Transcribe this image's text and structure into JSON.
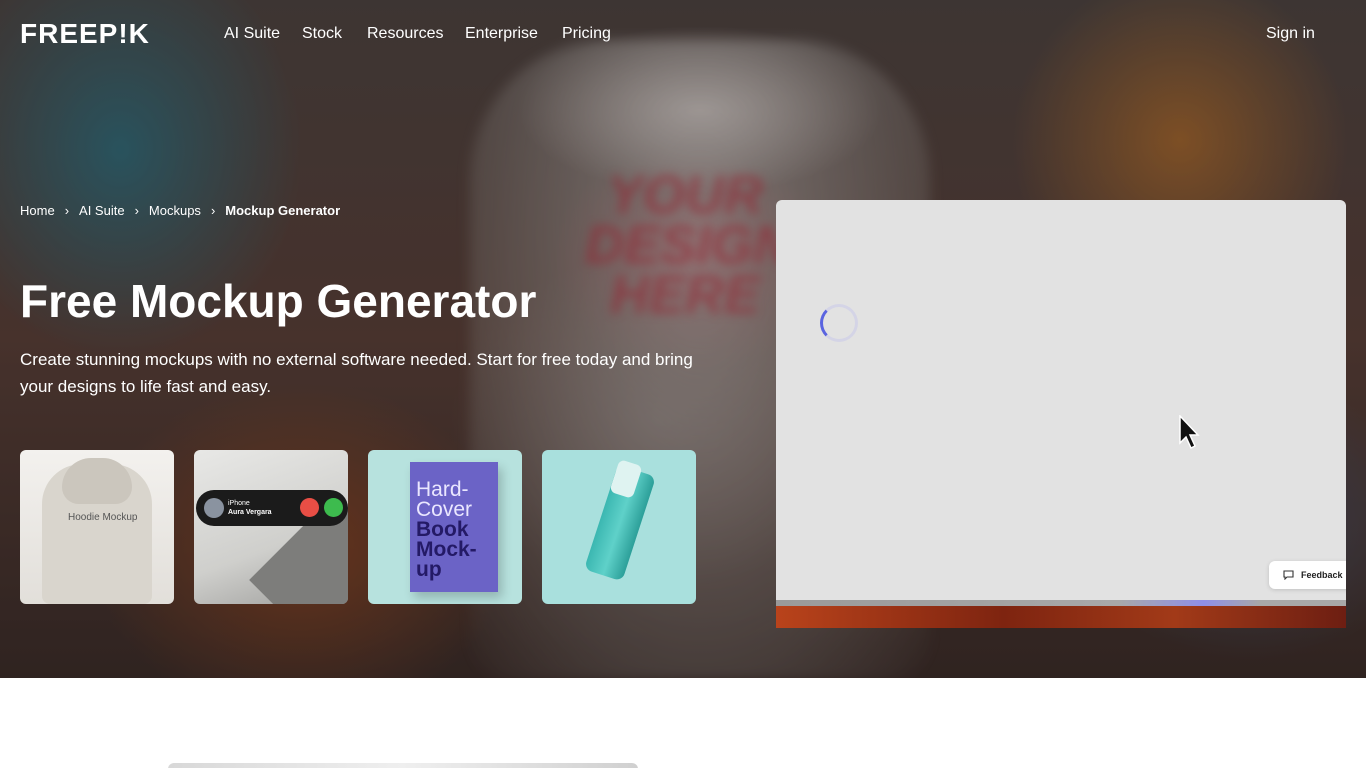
{
  "brand": {
    "logo_text": "FREEP!K"
  },
  "nav": {
    "items": [
      {
        "label": "AI Suite"
      },
      {
        "label": "Stock"
      },
      {
        "label": "Resources"
      },
      {
        "label": "Enterprise"
      },
      {
        "label": "Pricing"
      }
    ],
    "sign_in": "Sign in"
  },
  "breadcrumb": [
    {
      "label": "Home"
    },
    {
      "label": "AI Suite"
    },
    {
      "label": "Mockups"
    },
    {
      "label": "Mockup Generator"
    }
  ],
  "hero": {
    "title": "Free Mockup Generator",
    "subtitle": "Create stunning mockups with no external software needed. Start for free today and bring your designs to life fast and easy.",
    "background_print": "YOUR DESIGN HERE"
  },
  "thumbnails": [
    {
      "name": "hoodie",
      "text": "Hoodie Mockup"
    },
    {
      "name": "phone",
      "caller_label": "iPhone",
      "caller_name": "Aura Vergara"
    },
    {
      "name": "book",
      "text_light": "Hard-Cover",
      "text_dark": "Book Mock-up"
    },
    {
      "name": "bottle",
      "text": ""
    }
  ],
  "preview": {
    "feedback_label": "Feedback",
    "loading": true
  },
  "colors": {
    "accent": "#5a64e0",
    "preview_bg": "#e2e2e2",
    "hero_overlay": "#2a2020"
  }
}
